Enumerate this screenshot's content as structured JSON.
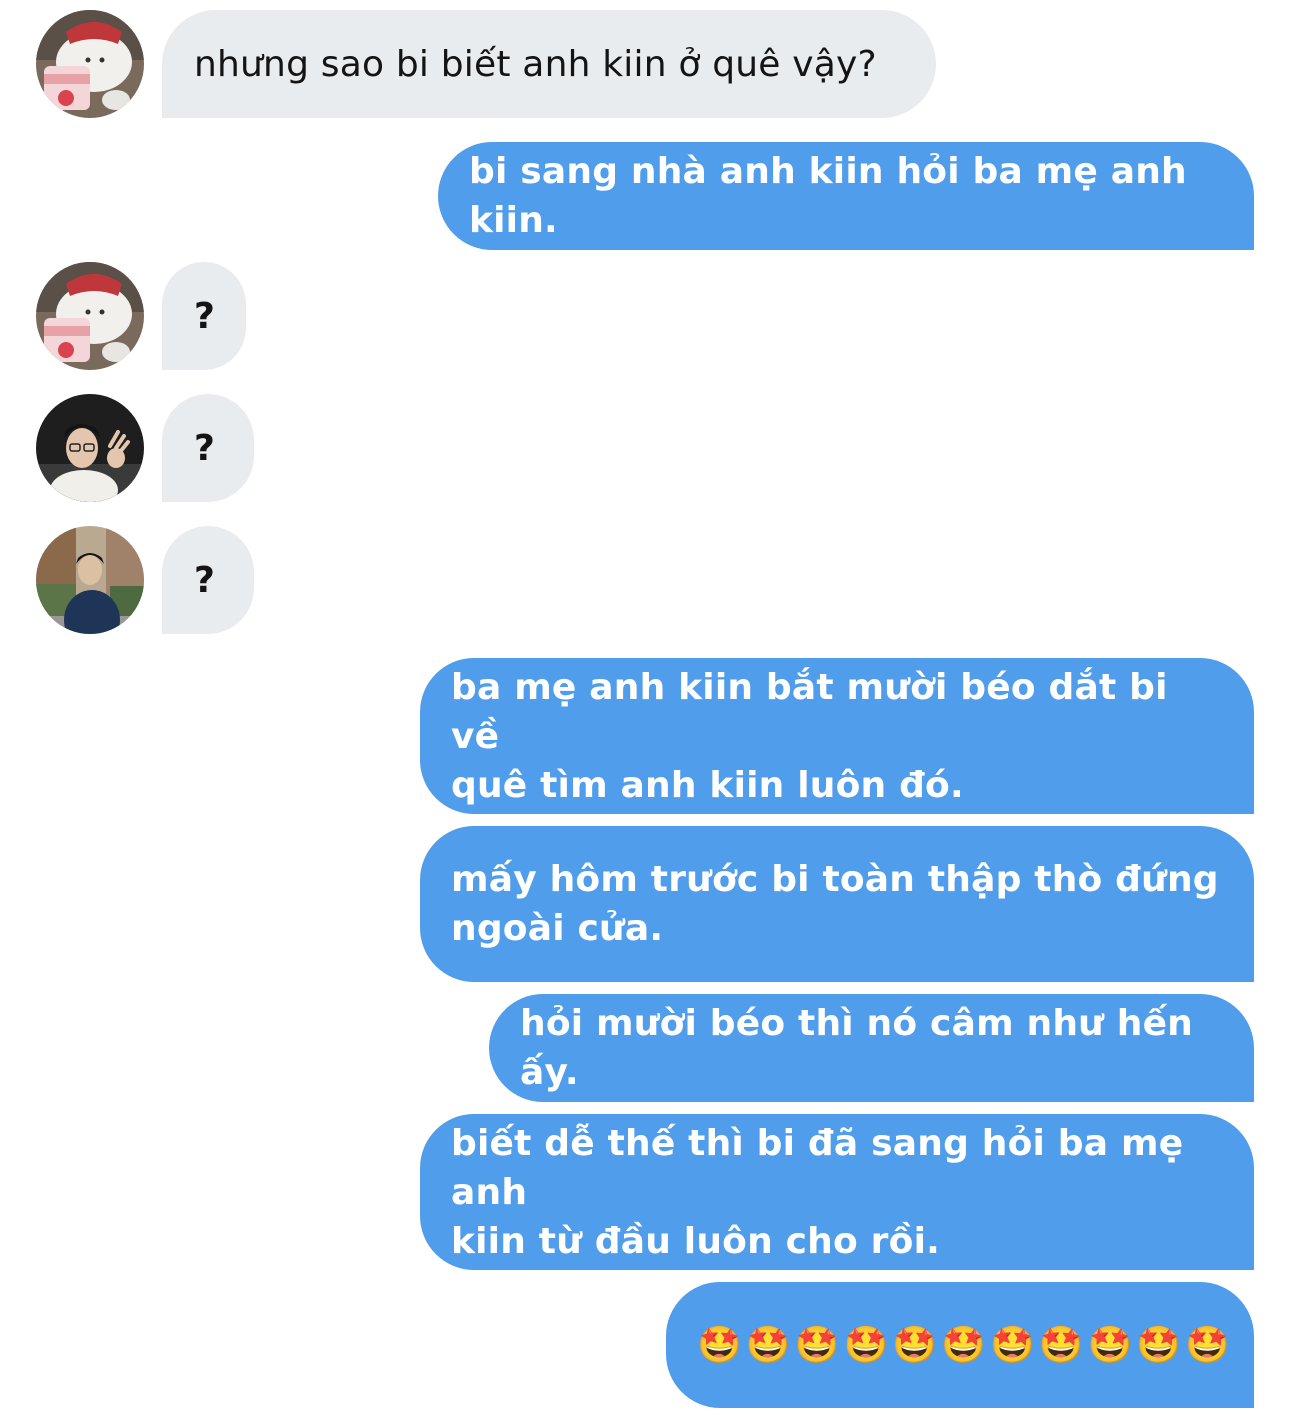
{
  "colors": {
    "incoming_bubble": "#e9ecef",
    "outgoing_bubble": "#4f9deb",
    "incoming_text": "#141414",
    "outgoing_text": "#ffffff"
  },
  "messages": [
    {
      "direction": "incoming",
      "avatar": "bear-sticker-avatar",
      "text": "nhưng sao bi biết anh kiin ở quê vậy?"
    },
    {
      "direction": "outgoing",
      "text": "bi sang nhà anh kiin hỏi ba mẹ anh kiin."
    },
    {
      "direction": "incoming",
      "avatar": "bear-sticker-avatar",
      "text": "?"
    },
    {
      "direction": "incoming",
      "avatar": "glasses-man-avatar",
      "text": "?"
    },
    {
      "direction": "incoming",
      "avatar": "street-man-avatar",
      "text": "?"
    },
    {
      "direction": "outgoing",
      "lines": [
        "ba mẹ anh kiin bắt mười béo dắt bi về",
        "quê tìm anh kiin luôn đó."
      ]
    },
    {
      "direction": "outgoing",
      "lines": [
        "mấy hôm trước bi toàn thập thò đứng",
        "ngoài cửa."
      ]
    },
    {
      "direction": "outgoing",
      "text": "hỏi mười béo thì nó câm như hến ấy."
    },
    {
      "direction": "outgoing",
      "lines": [
        "biết dễ thế thì bi đã sang hỏi ba mẹ anh",
        "kiin từ đầu luôn cho rồi."
      ]
    },
    {
      "direction": "outgoing",
      "text": "🤩🤩🤩🤩🤩🤩🤩🤩🤩🤩🤩"
    }
  ]
}
